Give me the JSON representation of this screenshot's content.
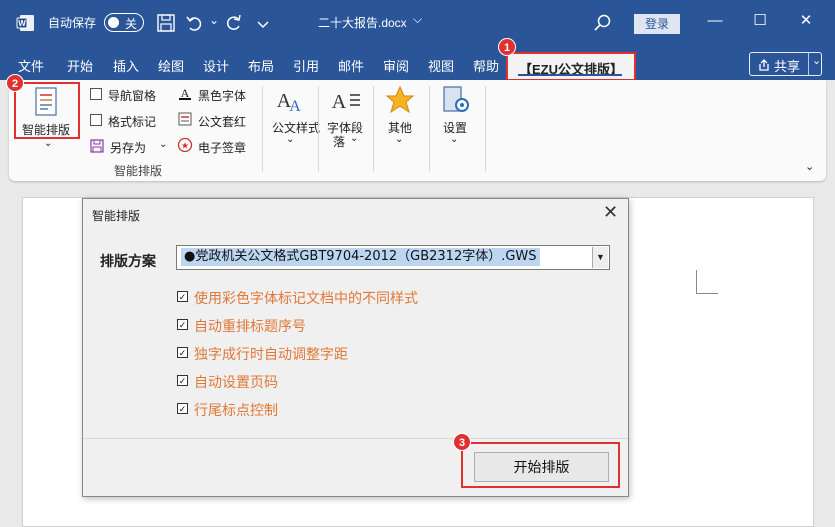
{
  "titlebar": {
    "autosave_label": "自动保存",
    "autosave_state": "关",
    "doc_name": "二十大报告.docx",
    "doc_name_chevron": "⌵",
    "login": "登录",
    "minimize": "—",
    "maximize": "☐",
    "close": "✕"
  },
  "menu": [
    "文件",
    "开始",
    "插入",
    "绘图",
    "设计",
    "布局",
    "引用",
    "邮件",
    "审阅",
    "视图",
    "帮助"
  ],
  "active_tab": "【EZU公文排版】",
  "share": {
    "label": "共享",
    "chevron": "⌄"
  },
  "ribbon": {
    "smart_layout": "智能排版",
    "smart_layout_chevron": "⌄",
    "nav_pane": "导航窗格",
    "format_mark": "格式标记",
    "save_as": "另存为",
    "save_as_chevron": "⌄",
    "black_font": "黑色字体",
    "red_header": "公文套红",
    "e_seal": "电子签章",
    "group_label": "智能排版",
    "doc_style": "公文样式",
    "doc_style_chevron": "⌄",
    "font_paragraph": "字体段落",
    "font_paragraph_chevron": "⌄",
    "other": "其他",
    "other_chevron": "⌄",
    "settings": "设置",
    "settings_chevron": "⌄",
    "collapse_chevron": "⌄"
  },
  "badges": [
    "1",
    "2",
    "3"
  ],
  "dialog": {
    "title": "智能排版",
    "close": "✕",
    "scheme_label": "排版方案",
    "scheme_value": "●党政机关公文格式GBT9704-2012（GB2312字体）.GWS",
    "scheme_arrow": "▼",
    "options": [
      {
        "label": "使用彩色字体标记文档中的不同样式",
        "checked": true,
        "mark": "✓"
      },
      {
        "label": "自动重排标题序号",
        "checked": true,
        "mark": "✓"
      },
      {
        "label": "独字成行时自动调整字距",
        "checked": true,
        "mark": "✓"
      },
      {
        "label": "自动设置页码",
        "checked": true,
        "mark": "✓"
      },
      {
        "label": "行尾标点控制",
        "checked": true,
        "mark": "✓"
      }
    ],
    "start_button": "开始排版"
  },
  "colors": {
    "accent": "#2a5699",
    "highlight": "#e0302f",
    "option_text": "#e07838"
  }
}
